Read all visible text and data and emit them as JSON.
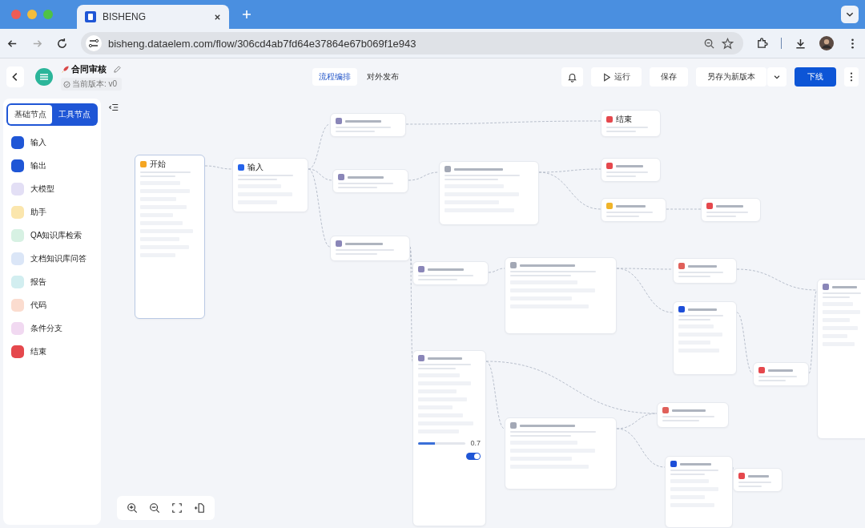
{
  "browser": {
    "tab_title": "BISHENG",
    "url": "bisheng.dataelem.com/flow/306cd4ab7fd64e37864e67b069f1e943"
  },
  "header": {
    "title": "合同审核",
    "version": "当前版本: v0",
    "tabs": [
      {
        "label": "流程编排",
        "selected": true
      },
      {
        "label": "对外发布",
        "selected": false
      }
    ],
    "run": "运行",
    "save": "保存",
    "save_as": "另存为新版本",
    "offline": "下线"
  },
  "sidebar": {
    "tabs": [
      {
        "label": "基础节点",
        "selected": true
      },
      {
        "label": "工具节点",
        "selected": false
      }
    ],
    "items": [
      {
        "label": "输入",
        "color": "#1f56d6"
      },
      {
        "label": "输出",
        "color": "#1f56d6"
      },
      {
        "label": "大模型",
        "color": "#e3dff5"
      },
      {
        "label": "助手",
        "color": "#fbe6ad"
      },
      {
        "label": "QA知识库检索",
        "color": "#d7f1e3"
      },
      {
        "label": "文档知识库问答",
        "color": "#dbe6f7"
      },
      {
        "label": "报告",
        "color": "#d2eef0"
      },
      {
        "label": "代码",
        "color": "#fbdccf"
      },
      {
        "label": "条件分支",
        "color": "#f1d9f1"
      },
      {
        "label": "结束",
        "color": "#e5484d"
      }
    ]
  },
  "canvas": {
    "nodes": [
      {
        "kind": "start",
        "title": "开始"
      },
      {
        "kind": "input",
        "title": "输入"
      },
      {
        "kind": "llm"
      },
      {
        "kind": "llm"
      },
      {
        "kind": "condition"
      },
      {
        "kind": "llm"
      },
      {
        "kind": "end",
        "title": "结束"
      },
      {
        "kind": "end"
      },
      {
        "kind": "assistant"
      },
      {
        "kind": "end"
      },
      {
        "kind": "llm"
      },
      {
        "kind": "condition"
      },
      {
        "kind": "report"
      },
      {
        "kind": "output"
      },
      {
        "kind": "llm",
        "level": 0.35,
        "reading": "0.7",
        "on": true
      },
      {
        "kind": "condition"
      },
      {
        "kind": "report"
      },
      {
        "kind": "end"
      },
      {
        "kind": "output"
      },
      {
        "kind": "end"
      },
      {
        "kind": "llm"
      }
    ]
  }
}
